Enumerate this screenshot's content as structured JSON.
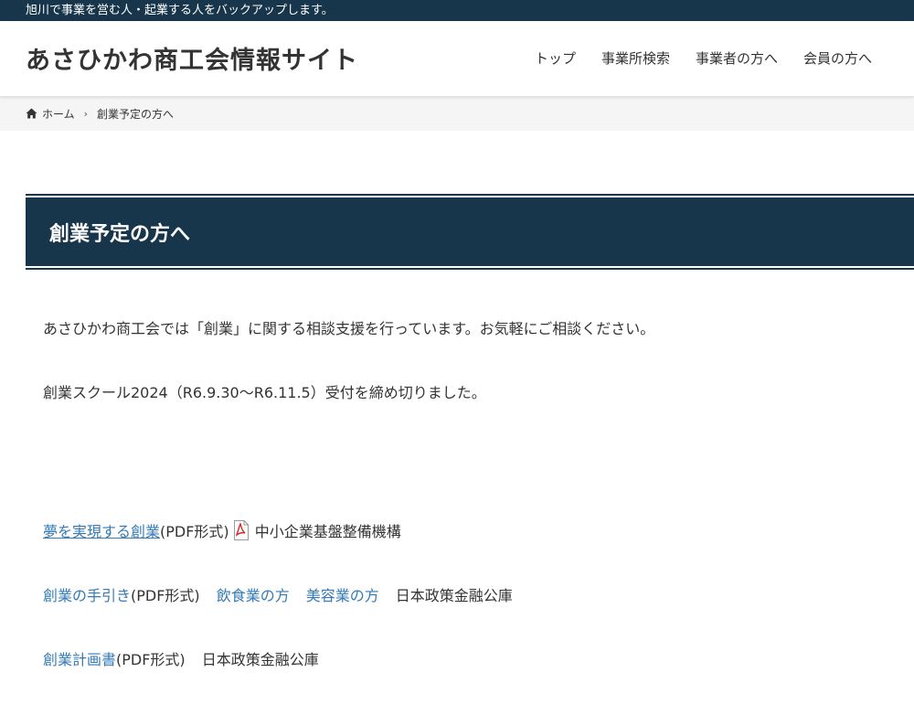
{
  "topbar": {
    "tagline": "旭川で事業を営む人・起業する人をバックアップします。"
  },
  "header": {
    "site_title": "あさひかわ商工会情報サイト"
  },
  "nav": {
    "items": [
      {
        "label": "トップ"
      },
      {
        "label": "事業所検索"
      },
      {
        "label": "事業者の方へ"
      },
      {
        "label": "会員の方へ"
      }
    ]
  },
  "breadcrumb": {
    "home": "ホーム",
    "separator": "›",
    "current": "創業予定の方へ"
  },
  "page": {
    "title": "創業予定の方へ"
  },
  "content": {
    "intro": "あさひかわ商工会では「創業」に関する相談支援を行っています。お気軽にご相談ください。",
    "notice": "創業スクール2024（R6.9.30～R6.11.5）受付を締め切りました。",
    "line1": {
      "link": "夢を実現する創業 ",
      "format": "(PDF形式)",
      "source": "中小企業基盤整備機構"
    },
    "line2": {
      "link1": "創業の手引き",
      "format": "(PDF形式)",
      "link2": "飲食業の方",
      "link3": "美容業の方",
      "source": "日本政策金融公庫"
    },
    "line3": {
      "link": "創業計画書",
      "format": "(PDF形式)",
      "source": "日本政策金融公庫"
    }
  },
  "icons": {
    "home": "home-icon",
    "pdf": "pdf-icon"
  },
  "colors": {
    "primary": "#17364b",
    "link": "#337ab7",
    "pdf_red": "#d42a2a"
  }
}
